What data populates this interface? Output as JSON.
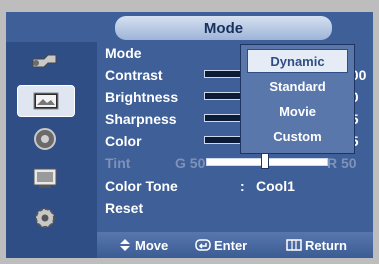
{
  "title": "Mode",
  "menu": [
    {
      "label": "Mode",
      "sep": ":",
      "value": "",
      "enabled": true
    },
    {
      "label": "Contrast",
      "value": "100",
      "level": 1.0,
      "enabled": true
    },
    {
      "label": "Brightness",
      "value": "50",
      "level": 0.5,
      "enabled": true
    },
    {
      "label": "Sharpness",
      "value": "75",
      "level": 0.75,
      "enabled": true
    },
    {
      "label": "Color",
      "value": "55",
      "level": 0.55,
      "enabled": true
    },
    {
      "label": "Tint",
      "left": "G 50",
      "right": "R 50",
      "level": 0.5,
      "enabled": false
    },
    {
      "label": "Color Tone",
      "sep": ":",
      "value": "Cool1",
      "enabled": true
    },
    {
      "label": "Reset",
      "enabled": true
    }
  ],
  "popup": {
    "options": [
      "Dynamic",
      "Standard",
      "Movie",
      "Custom"
    ],
    "selected": "Dynamic"
  },
  "footer": {
    "move": "Move",
    "enter": "Enter",
    "return": "Return"
  },
  "sidebar_icons": [
    "input-plug-icon",
    "picture-icon",
    "sound-speaker-icon",
    "channel-icon",
    "setup-gear-icon"
  ]
}
